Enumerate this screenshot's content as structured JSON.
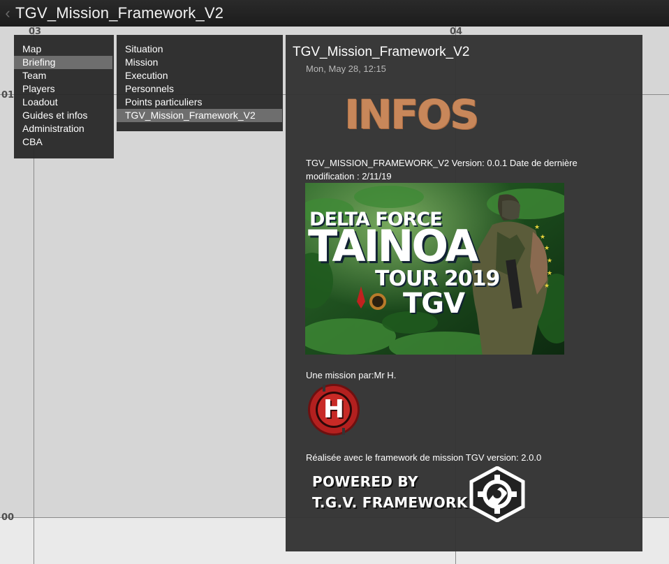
{
  "window": {
    "title": "TGV_Mission_Framework_V2",
    "back_icon": "chevron-left-icon"
  },
  "map": {
    "grid_labels": {
      "col_03": "03",
      "col_04": "04",
      "row_01": "01",
      "row_00": "00"
    },
    "colors": {
      "background": "#d6d6d6",
      "grid": "#8a8a8a",
      "label": "#4e4e4e"
    }
  },
  "menu_main": {
    "items": [
      {
        "label": "Map",
        "selected": false
      },
      {
        "label": "Briefing",
        "selected": true
      },
      {
        "label": "Team",
        "selected": false
      },
      {
        "label": "Players",
        "selected": false
      },
      {
        "label": "Loadout",
        "selected": false
      },
      {
        "label": "Guides et infos",
        "selected": false
      },
      {
        "label": "Administration",
        "selected": false
      },
      {
        "label": "CBA",
        "selected": false
      }
    ]
  },
  "menu_sub": {
    "items": [
      {
        "label": "Situation",
        "selected": false
      },
      {
        "label": "Mission",
        "selected": false
      },
      {
        "label": "Execution",
        "selected": false
      },
      {
        "label": "Personnels",
        "selected": false
      },
      {
        "label": "Points particuliers",
        "selected": false
      },
      {
        "label": "TGV_Mission_Framework_V2",
        "selected": true
      }
    ]
  },
  "content": {
    "title": "TGV_Mission_Framework_V2",
    "date": "Mon, May 28,  12:15",
    "infos_logo_text": "INFOS",
    "version_line": "TGV_MISSION_FRAMEWORK_V2 Version: 0.0.1 Date de dernière modification : 2/11/19",
    "banner": {
      "line1": "DELTA FORCE",
      "line2": "TAINOA",
      "line3": "TOUR 2019",
      "line4": "TGV"
    },
    "author_line": "Une mission par:Mr H.",
    "author_logo_letter": "H",
    "framework_line": "Réalisée avec le framework de mission TGV version: 2.0.0",
    "powered_by": {
      "line1": "POWERED BY",
      "line2": "T.G.V. FRAMEWORK",
      "icon": "gear-wrench-icon"
    }
  },
  "colors": {
    "menu_bg": "#2a2a2a",
    "selected_bg": "#6e6e6e",
    "panel_bg": "#343434",
    "infos_orange": "#c8875a",
    "logo_red": "#b3201f"
  }
}
